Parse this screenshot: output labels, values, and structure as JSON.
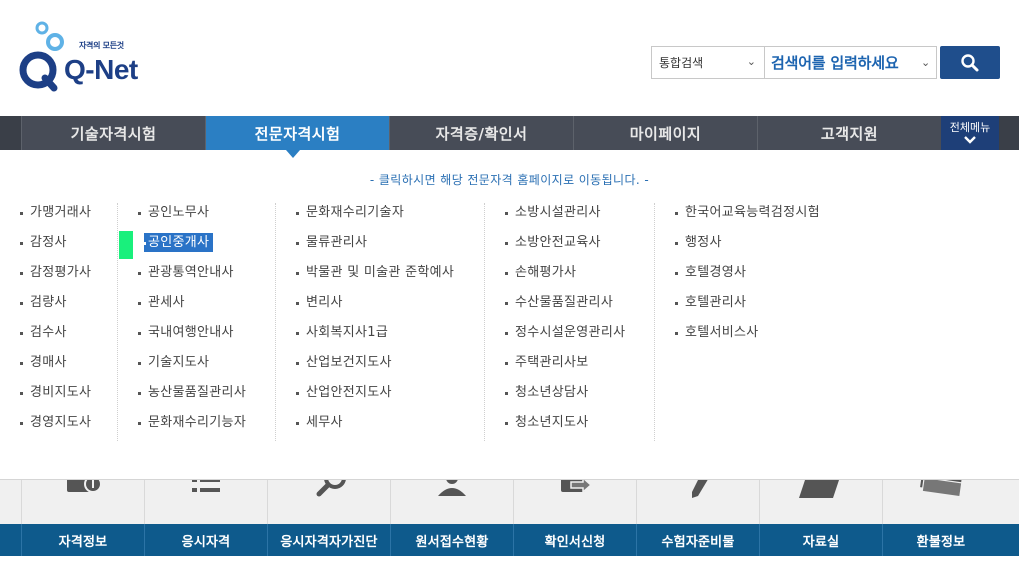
{
  "header": {
    "logo_tagline": "자격의 모든것",
    "logo_text": "Q-Net",
    "search_scope": "통합검색",
    "search_placeholder": "검색어를 입력하세요",
    "search_icon": "search-icon"
  },
  "gnb": {
    "items": [
      {
        "label": "기술자격시험"
      },
      {
        "label": "전문자격시험"
      },
      {
        "label": "자격증/확인서"
      },
      {
        "label": "마이페이지"
      },
      {
        "label": "고객지원"
      }
    ],
    "active_index": 1,
    "all_menu_label": "전체메뉴"
  },
  "panel": {
    "notice": "- 클릭하시면 해당 전문자격 홈페이지로 이동됩니다. -",
    "columns": [
      [
        "가맹거래사",
        "감정사",
        "감정평가사",
        "검량사",
        "검수사",
        "경매사",
        "경비지도사",
        "경영지도사"
      ],
      [
        "공인노무사",
        "공인중개사",
        "관광통역안내사",
        "관세사",
        "국내여행안내사",
        "기술지도사",
        "농산물품질관리사",
        "문화재수리기능자"
      ],
      [
        "문화재수리기술자",
        "물류관리사",
        "박물관 및 미술관 준학예사",
        "변리사",
        "사회복지사1급",
        "산업보건지도사",
        "산업안전지도사",
        "세무사"
      ],
      [
        "소방시설관리사",
        "소방안전교육사",
        "손해평가사",
        "수산물품질관리사",
        "정수시설운영관리사",
        "주택관리사보",
        "청소년상담사",
        "청소년지도사"
      ],
      [
        "한국어교육능력검정시험",
        "행정사",
        "호텔경영사",
        "호텔관리사",
        "호텔서비스사"
      ]
    ],
    "highlighted": "공인중개사"
  },
  "quick_menu": {
    "items": [
      {
        "label": "자격정보",
        "icon": "info-book-icon"
      },
      {
        "label": "응시자격",
        "icon": "list-icon"
      },
      {
        "label": "응시자격자가진단",
        "icon": "magnifier-icon"
      },
      {
        "label": "원서접수현황",
        "icon": "people-icon"
      },
      {
        "label": "확인서신청",
        "icon": "document-arrow-icon"
      },
      {
        "label": "수험자준비물",
        "icon": "pencil-icon"
      },
      {
        "label": "자료실",
        "icon": "folder-icon"
      },
      {
        "label": "환불정보",
        "icon": "money-icon"
      }
    ]
  },
  "colors": {
    "brand_navy": "#1d3f86",
    "gnb_bg": "#474c57",
    "gnb_active": "#2b7fc3",
    "quick_bar": "#0e5a8c",
    "highlight": "#2a73c7"
  }
}
